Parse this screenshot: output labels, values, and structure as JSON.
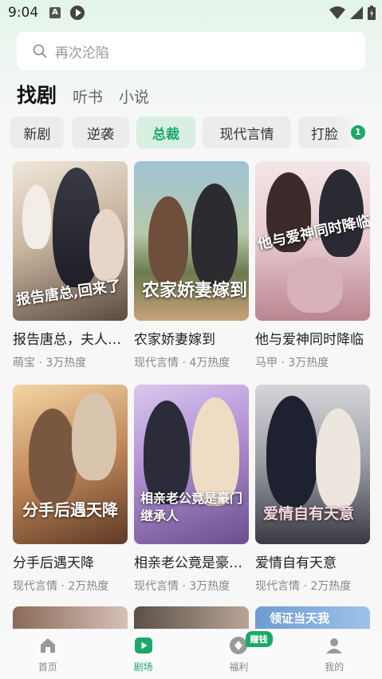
{
  "status_bar": {
    "time": "9:04",
    "notif_a": "A"
  },
  "search": {
    "placeholder": "再次沦陷"
  },
  "tabs": [
    {
      "label": "找剧",
      "active": true
    },
    {
      "label": "听书",
      "active": false
    },
    {
      "label": "小说",
      "active": false
    }
  ],
  "categories": [
    {
      "label": "新剧",
      "active": false
    },
    {
      "label": "逆袭",
      "active": false
    },
    {
      "label": "总裁",
      "active": true
    },
    {
      "label": "现代言情",
      "active": false
    },
    {
      "label": "打脸",
      "active": false
    }
  ],
  "category_badge": "1",
  "dramas": [
    {
      "title": "报告唐总，夫人带着崽回来了",
      "poster_text": "报告唐总,回来了",
      "meta": "萌宝 · 3万热度"
    },
    {
      "title": "农家娇妻嫁到",
      "poster_text": "农家娇妻嫁到",
      "meta": "现代言情 · 4万热度"
    },
    {
      "title": "他与爱神同时降临",
      "poster_text": "他与爱神同时降临",
      "meta": "马甲 · 3万热度"
    },
    {
      "title": "分手后遇天降",
      "poster_text": "分手后遇天降",
      "meta": "现代言情 · 2万热度"
    },
    {
      "title": "相亲老公竟是豪门继承人",
      "poster_text": "相亲老公竟是豪门继承人",
      "meta": "现代言情 · 3万热度"
    },
    {
      "title": "爱情自有天意",
      "poster_text": "爱情自有天意",
      "meta": "现代言情 · 2万热度"
    }
  ],
  "partial_row_text": "领证当天我",
  "nav": [
    {
      "label": "首页",
      "icon": "home-icon",
      "active": false
    },
    {
      "label": "剧场",
      "icon": "theater-play-icon",
      "active": true
    },
    {
      "label": "福利",
      "icon": "gift-coin-icon",
      "active": false
    },
    {
      "label": "我的",
      "icon": "profile-icon",
      "active": false
    }
  ],
  "earn_badge": "赚钱",
  "colors": {
    "accent": "#1aa968",
    "chip_bg": "#ebecec",
    "chip_active_bg": "#d8efe2"
  }
}
